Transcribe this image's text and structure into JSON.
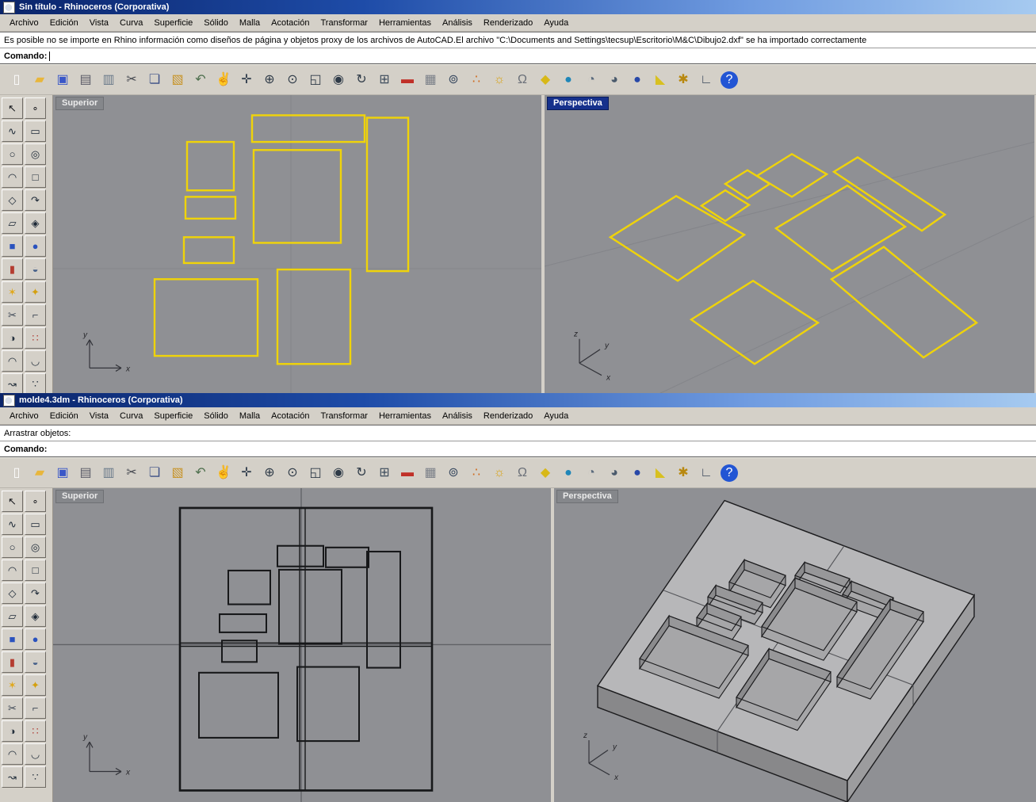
{
  "menus": [
    "Archivo",
    "Edición",
    "Vista",
    "Curva",
    "Superficie",
    "Sólido",
    "Malla",
    "Acotación",
    "Transformar",
    "Herramientas",
    "Análisis",
    "Renderizado",
    "Ayuda"
  ],
  "window1": {
    "title": "Sin título - Rhinoceros (Corporativa)",
    "history": "Es posible no se importe en Rhino información como diseños de página y objetos proxy de los archivos de AutoCAD.El archivo \"C:\\Documents and Settings\\tecsup\\Escritorio\\M&C\\Dibujo2.dxf\" se ha importado correctamente",
    "command_label": "Comando:"
  },
  "window2": {
    "title": "molde4.3dm - Rhinoceros (Corporativa)",
    "history": "Arrastrar objetos:",
    "command_label": "Comando:"
  },
  "viewport_labels": {
    "top": "Superior",
    "perspective": "Perspectiva"
  },
  "axis": {
    "x": "x",
    "y": "y",
    "z": "z"
  },
  "toolbar_icons": [
    {
      "name": "new-file-icon",
      "glyph": "▯",
      "color": "#fdfdfd"
    },
    {
      "name": "open-folder-icon",
      "glyph": "▰",
      "color": "#e8b63c"
    },
    {
      "name": "save-icon",
      "glyph": "▣",
      "color": "#3a57c8"
    },
    {
      "name": "print-icon",
      "glyph": "▤",
      "color": "#5a5a66"
    },
    {
      "name": "copy-view-icon",
      "glyph": "▥",
      "color": "#6a7a8a"
    },
    {
      "name": "cut-icon",
      "glyph": "✂",
      "color": "#44474f"
    },
    {
      "name": "copy-icon",
      "glyph": "❏",
      "color": "#3b4e86"
    },
    {
      "name": "paste-icon",
      "glyph": "▧",
      "color": "#c79326"
    },
    {
      "name": "undo-icon",
      "glyph": "↶",
      "color": "#4c6e4c"
    },
    {
      "name": "pan-hand-icon",
      "glyph": "✌",
      "color": "#b98d62"
    },
    {
      "name": "move-icon",
      "glyph": "✛",
      "color": "#33404f"
    },
    {
      "name": "zoom-icon",
      "glyph": "⊕",
      "color": "#2f3b48"
    },
    {
      "name": "zoom-dynamic-icon",
      "glyph": "⊙",
      "color": "#2f3b48"
    },
    {
      "name": "zoom-window-icon",
      "glyph": "◱",
      "color": "#2f3b48"
    },
    {
      "name": "zoom-extents-icon",
      "glyph": "◉",
      "color": "#2f3b48"
    },
    {
      "name": "rotate-view-icon",
      "glyph": "↻",
      "color": "#2f3b48"
    },
    {
      "name": "viewport-layout-icon",
      "glyph": "⊞",
      "color": "#3d4c5c"
    },
    {
      "name": "shade-car-icon",
      "glyph": "▬",
      "color": "#c03028"
    },
    {
      "name": "mesh-grid-icon",
      "glyph": "▦",
      "color": "#7a7f88"
    },
    {
      "name": "cplane-icon",
      "glyph": "⊚",
      "color": "#3c4c62"
    },
    {
      "name": "osnap-nodes-icon",
      "glyph": "∴",
      "color": "#d06a1e"
    },
    {
      "name": "lightbulb-icon",
      "glyph": "☼",
      "color": "#d8a418"
    },
    {
      "name": "lock-icon",
      "glyph": "Ω",
      "color": "#6a6f78"
    },
    {
      "name": "layer-kite-icon",
      "glyph": "◆",
      "color": "#d8b818"
    },
    {
      "name": "render-globe-icon",
      "glyph": "●",
      "color": "#1f86b8"
    },
    {
      "name": "wireframe-sphere-icon",
      "glyph": "◔",
      "color": "#5a6a7c"
    },
    {
      "name": "shaded-sphere-icon",
      "glyph": "◕",
      "color": "#4a5a6c"
    },
    {
      "name": "rendered-sphere-icon",
      "glyph": "●",
      "color": "#2848a8"
    },
    {
      "name": "flag-icon",
      "glyph": "◣",
      "color": "#d8c020"
    },
    {
      "name": "gear-icon",
      "glyph": "✱",
      "color": "#b8880f"
    },
    {
      "name": "cplane-axis-icon",
      "glyph": "∟",
      "color": "#39465a"
    },
    {
      "name": "help-icon",
      "glyph": "?",
      "color": "#ffffff",
      "bg": "#2255d4"
    }
  ],
  "palette_icons": [
    {
      "name": "select-arrow-icon",
      "glyph": "↖",
      "color": "#16181c"
    },
    {
      "name": "point-icon",
      "glyph": "∘",
      "color": "#16181c"
    },
    {
      "name": "curve-interpolate-icon",
      "glyph": "∿",
      "color": "#1c2836"
    },
    {
      "name": "control-point-curve-icon",
      "glyph": "▭",
      "color": "#1c2836"
    },
    {
      "name": "circle-tool-icon",
      "glyph": "○",
      "color": "#1c2836"
    },
    {
      "name": "circle-tangent-icon",
      "glyph": "◎",
      "color": "#1c2836"
    },
    {
      "name": "arc-tool-icon",
      "glyph": "◠",
      "color": "#1c2836"
    },
    {
      "name": "rectangle-tool-icon",
      "glyph": "□",
      "color": "#1c2836"
    },
    {
      "name": "polygon-tool-icon",
      "glyph": "◇",
      "color": "#1c2836"
    },
    {
      "name": "freeform-curve-icon",
      "glyph": "↷",
      "color": "#1c2836"
    },
    {
      "name": "surface-plane-icon",
      "glyph": "▱",
      "color": "#1c2836"
    },
    {
      "name": "sweep-surface-icon",
      "glyph": "◈",
      "color": "#1c2836"
    },
    {
      "name": "box-tool-icon",
      "glyph": "■",
      "color": "#2a52be"
    },
    {
      "name": "sphere-tool-icon",
      "glyph": "●",
      "color": "#2a52be"
    },
    {
      "name": "cylinder-tool-icon",
      "glyph": "▮",
      "color": "#b43c30"
    },
    {
      "name": "torus-tool-icon",
      "glyph": "◒",
      "color": "#47618a"
    },
    {
      "name": "explode-tool-icon",
      "glyph": "✶",
      "color": "#e0a81c"
    },
    {
      "name": "fillet-tool-icon",
      "glyph": "✦",
      "color": "#d4a00f"
    },
    {
      "name": "trim-tool-icon",
      "glyph": "✂",
      "color": "#3c4654"
    },
    {
      "name": "extend-tool-icon",
      "glyph": "⌐",
      "color": "#3c4654"
    },
    {
      "name": "boolean-tool-icon",
      "glyph": "◑",
      "color": "#24303c"
    },
    {
      "name": "array-tool-icon",
      "glyph": "∷",
      "color": "#b04038"
    },
    {
      "name": "blend-curve-icon",
      "glyph": "◠",
      "color": "#24303c"
    },
    {
      "name": "adjust-end-icon",
      "glyph": "◡",
      "color": "#24303c"
    },
    {
      "name": "curve-handle-icon",
      "glyph": "↝",
      "color": "#24303c"
    },
    {
      "name": "points-on-icon",
      "glyph": "∵",
      "color": "#24303c"
    }
  ]
}
